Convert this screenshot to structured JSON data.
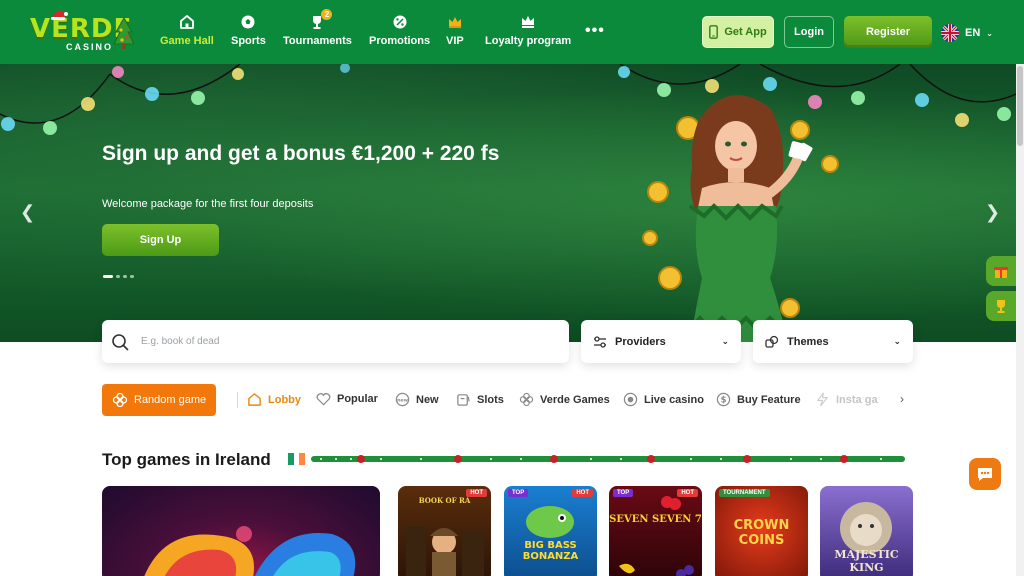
{
  "logo": {
    "name": "VERDE",
    "sub": "CASINO"
  },
  "nav": [
    {
      "label": "Game Hall",
      "icon": "home-icon",
      "active": true
    },
    {
      "label": "Sports",
      "icon": "soccer-ball-icon"
    },
    {
      "label": "Tournaments",
      "icon": "trophy-icon",
      "badge": "2"
    },
    {
      "label": "Promotions",
      "icon": "percent-badge-icon"
    },
    {
      "label": "VIP",
      "icon": "crown-icon"
    },
    {
      "label": "Loyalty program",
      "icon": "loyalty-crown-icon"
    }
  ],
  "header": {
    "get_app": "Get App",
    "login": "Login",
    "register": "Register",
    "language": "EN"
  },
  "hero": {
    "title": "Sign up and get a bonus €1,200 + 220 fs",
    "subtitle": "Welcome package for the first four deposits",
    "cta": "Sign Up",
    "slides": 4,
    "active_slide": 1
  },
  "search": {
    "placeholder": "E.g. book of dead",
    "providers_label": "Providers",
    "themes_label": "Themes"
  },
  "categories": {
    "random_label": "Random game",
    "items": [
      {
        "label": "Lobby",
        "icon": "home-icon",
        "active": true
      },
      {
        "label": "Popular",
        "icon": "heart-icon"
      },
      {
        "label": "New",
        "icon": "new-tag-icon"
      },
      {
        "label": "Slots",
        "icon": "slot-machine-icon"
      },
      {
        "label": "Verde Games",
        "icon": "clover-icon"
      },
      {
        "label": "Live casino",
        "icon": "live-dot-icon"
      },
      {
        "label": "Buy Feature",
        "icon": "dollar-coin-icon"
      },
      {
        "label": "Insta ga",
        "icon": "instant-icon"
      }
    ]
  },
  "top_games": {
    "title": "Top games in Ireland",
    "games": [
      {
        "title": "",
        "tag": ""
      },
      {
        "title": "BOOK OF RA",
        "tag": "HOT"
      },
      {
        "title": "BIG BASS BONANZA",
        "tag": "HOT",
        "tag2": "TOP"
      },
      {
        "title": "SEVEN SEVEN 7",
        "tag": "HOT",
        "tag2": "TOP"
      },
      {
        "title": "CROWN COINS",
        "tag": "TOURNAMENT"
      },
      {
        "title": "MAJESTIC KING",
        "tag": ""
      }
    ]
  },
  "colors": {
    "header_green": "#0c8a3c",
    "accent_lime": "#c7ef3a",
    "cta_green": "#5aa82a",
    "orange": "#f2780c"
  }
}
